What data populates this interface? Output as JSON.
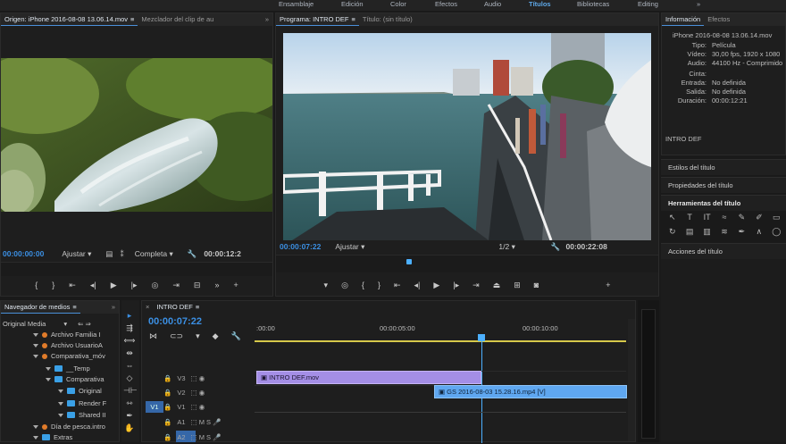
{
  "workspaces": [
    "Ensamblaje",
    "Edición",
    "Color",
    "Efectos",
    "Audio",
    "Títulos",
    "Bibliotecas",
    "Editing"
  ],
  "active_workspace": "Títulos",
  "source": {
    "tab_label": "Origen: iPhone 2016-08-08 13.06.14.mov",
    "tab2_label": "Mezclador del clip de au",
    "timecode": "00:00:00:00",
    "fit_label": "Ajustar",
    "quality_label": "Completa",
    "duration": "00:00:12:2"
  },
  "program": {
    "tab_label": "Programa: INTRO DEF",
    "tab2_label": "Título: (sin título)",
    "timecode": "00:00:07:22",
    "fit_label": "Ajustar",
    "fraction": "1/2",
    "duration": "00:00:22:08"
  },
  "info": {
    "tab_label": "Información",
    "tab2_label": "Efectos",
    "filename": "iPhone 2016-08-08 13.06.14.mov",
    "tipo_label": "Tipo:",
    "tipo": "Película",
    "video_label": "Vídeo:",
    "video": "30,00 fps, 1920 x 1080",
    "audio_label": "Audio:",
    "audio": "44100 Hz - Comprimido",
    "cinta_label": "Cinta:",
    "entrada_label": "Entrada:",
    "entrada": "No definida",
    "salida_label": "Salida:",
    "salida": "No definida",
    "duracion_label": "Duración:",
    "duracion": "00:00:12:21",
    "seq_name": "INTRO DEF"
  },
  "side_panels": {
    "estilos": "Estilos del título",
    "propiedades": "Propiedades del título",
    "herramientas": "Herramientas del título",
    "acciones": "Acciones del título"
  },
  "media": {
    "tab_label": "Navegador de medios",
    "root": "Original Media",
    "items": [
      "Archivo Familia I",
      "Archivo UsuarioA",
      "Comparativa_móv",
      "__Temp",
      "Comparativa",
      "Original",
      "Render F",
      "Shared II",
      "Día de pesca.intro",
      "Extras"
    ]
  },
  "timeline": {
    "tab_label": "INTRO DEF",
    "timecode": "00:00:07:22",
    "ruler_labels": [
      ":00:00",
      "00:00:05:00",
      "00:00:10:00"
    ],
    "tracks": [
      "V3",
      "V2",
      "V1",
      "A1",
      "A2"
    ],
    "clip1": "INTRO DEF.mov",
    "clip2": "GS 2016-08-03 15.28.16.mp4 [V]",
    "v1_src": "V1",
    "a1_src": "A1"
  },
  "colors": {
    "accent": "#3b8fe3",
    "clip_purple": "#a48ee6",
    "clip_blue": "#5fa7f0",
    "playhead": "#4cb0ff"
  }
}
